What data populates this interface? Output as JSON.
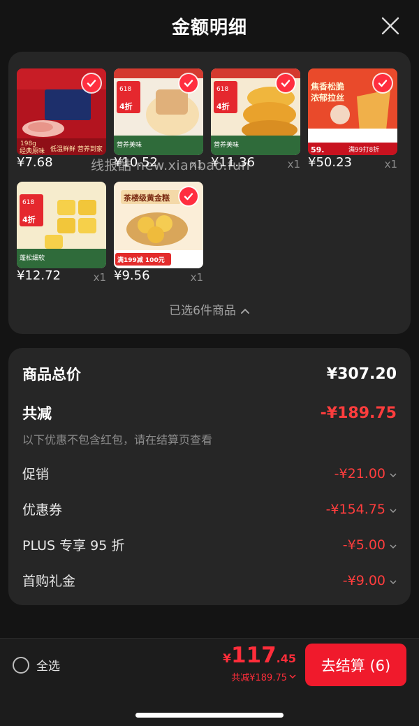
{
  "header": {
    "title": "金额明细",
    "close_icon": "close-icon"
  },
  "products": [
    {
      "price": "¥7.68",
      "quantity": "",
      "image_text": [
        "198g",
        "经典原味",
        "低温鲜鲜 营养到家"
      ]
    },
    {
      "price": "¥10.52",
      "quantity": "x1",
      "image_text": [
        "618",
        "4折",
        "营养美味"
      ]
    },
    {
      "price": "¥11.36",
      "quantity": "x1",
      "image_text": [
        "618",
        "4折",
        "营养美味"
      ]
    },
    {
      "price": "¥50.23",
      "quantity": "x1",
      "image_text": [
        "焦香松脆",
        "浓郁拉丝",
        "59.",
        "满99打8折"
      ]
    },
    {
      "price": "¥12.72",
      "quantity": "x1",
      "image_text": [
        "618",
        "4折",
        "蓬松细软"
      ]
    },
    {
      "price": "¥9.56",
      "quantity": "x1",
      "image_text": [
        "茶楼级黄金糕",
        "满199减 100元"
      ]
    }
  ],
  "watermark": "线报酷 new.xianbao.fun",
  "selected_count": "已选6件商品",
  "summary": {
    "total_label": "商品总价",
    "total_value": "¥307.20",
    "discount_label": "共减",
    "discount_value": "-¥189.75",
    "note": "以下优惠不包含红包，请在结算页查看",
    "items": [
      {
        "label": "促销",
        "value": "-¥21.00"
      },
      {
        "label": "优惠券",
        "value": "-¥154.75"
      },
      {
        "label": "PLUS 专享 95 折",
        "value": "-¥5.00"
      },
      {
        "label": "首购礼金",
        "value": "-¥9.00"
      }
    ]
  },
  "bottom": {
    "select_all": "全选",
    "currency": "¥",
    "amount_int": "117",
    "amount_dec": ".45",
    "discount_sub": "共减¥189.75",
    "checkout_label": "去结算 (6)"
  },
  "colors": {
    "background": "#141414",
    "card": "#262626",
    "accent_red": "#f01a2c",
    "discount_red": "#ff3d3d"
  }
}
